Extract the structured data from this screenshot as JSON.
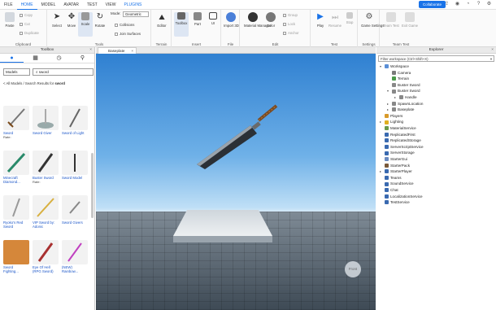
{
  "menubar": {
    "file": "FILE",
    "tabs": [
      "HOME",
      "MODEL",
      "AVATAR",
      "TEST",
      "VIEW",
      "PLUGINS"
    ],
    "collaborate": "Collaborate"
  },
  "ribbon": {
    "clipboard": {
      "paste": "Paste",
      "copy": "Copy",
      "cut": "Cut",
      "duplicate": "Duplicate",
      "label": "Clipboard"
    },
    "tools": {
      "select": "Select",
      "move": "Move",
      "scale": "Scale",
      "rotate": "Rotate",
      "label": "Tools"
    },
    "mode": {
      "label": "Mode:",
      "value": "Geometric",
      "collisions": "Collisions",
      "join_surfaces": "Join Surfaces"
    },
    "terrain": {
      "editor": "Editor",
      "label": "Terrain"
    },
    "insert": {
      "toolbox": "Toolbox",
      "part": "Part",
      "ui": "UI",
      "label": "Insert"
    },
    "file": {
      "import3d": "Import 3D",
      "label": "File"
    },
    "edit": {
      "material_manager": "Material Manager",
      "color": "Color",
      "group": "Group",
      "lock": "Lock",
      "anchor": "Anchor",
      "label": "Edit"
    },
    "test": {
      "play": "Play",
      "resume": "Resume",
      "stop": "Stop",
      "label": "Test"
    },
    "settings": {
      "game_settings": "Game Settings",
      "label": "Settings"
    },
    "team_test": {
      "team_test": "Team Test",
      "exit_game": "Exit Game",
      "label": "Team Test"
    }
  },
  "toolbox": {
    "title": "Toolbox",
    "category": "Models",
    "search": "sword",
    "crumb_prefix": "< All Models / Search Results for ",
    "crumb_term": "sword",
    "items": [
      {
        "name": "Sword",
        "rate": "Rate:"
      },
      {
        "name": "Sword Giver",
        "rate": ""
      },
      {
        "name": "Sword of Light",
        "rate": ""
      },
      {
        "name": "Minecraft Diamond...",
        "rate": ""
      },
      {
        "name": "Buster Sword",
        "rate": "Rate:"
      },
      {
        "name": "Sword Model",
        "rate": ""
      },
      {
        "name": "Ryoko's Red Sword",
        "rate": ""
      },
      {
        "name": "VIP Sword by: Adonic",
        "rate": ""
      },
      {
        "name": "Sword Givers",
        "rate": ""
      },
      {
        "name": "Sword Fighting...",
        "rate": ""
      },
      {
        "name": "Eye Of Hell (RPG Sword)",
        "rate": ""
      },
      {
        "name": "(NEW) Rainbow...",
        "rate": ""
      }
    ]
  },
  "viewport": {
    "tab": "Baseplate",
    "cube_label": "Front"
  },
  "explorer": {
    "title": "Explorer",
    "filter": "Filter workspace (Ctrl+Shift+X)",
    "tree": [
      {
        "label": "Workspace",
        "depth": 0,
        "arrow": "▾",
        "color": "#5b8fd6"
      },
      {
        "label": "Camera",
        "depth": 1,
        "arrow": "",
        "color": "#7a7a7a"
      },
      {
        "label": "Terrain",
        "depth": 1,
        "arrow": "",
        "color": "#4a9a4a"
      },
      {
        "label": "Buster Sword",
        "depth": 1,
        "arrow": "",
        "color": "#888"
      },
      {
        "label": "Buster Sword",
        "depth": 1,
        "arrow": "▾",
        "color": "#888"
      },
      {
        "label": "Handle",
        "depth": 2,
        "arrow": "▸",
        "color": "#888"
      },
      {
        "label": "SpawnLocation",
        "depth": 1,
        "arrow": "▸",
        "color": "#888"
      },
      {
        "label": "Baseplate",
        "depth": 1,
        "arrow": "▸",
        "color": "#888"
      },
      {
        "label": "Players",
        "depth": 0,
        "arrow": "",
        "color": "#d89a2a"
      },
      {
        "label": "Lighting",
        "depth": 0,
        "arrow": "▸",
        "color": "#e0b020"
      },
      {
        "label": "MaterialService",
        "depth": 0,
        "arrow": "",
        "color": "#6a9a4a"
      },
      {
        "label": "ReplicatedFirst",
        "depth": 0,
        "arrow": "",
        "color": "#3a6ab0"
      },
      {
        "label": "ReplicatedStorage",
        "depth": 0,
        "arrow": "",
        "color": "#3a6ab0"
      },
      {
        "label": "ServerScriptService",
        "depth": 0,
        "arrow": "",
        "color": "#3a6ab0"
      },
      {
        "label": "ServerStorage",
        "depth": 0,
        "arrow": "",
        "color": "#3a6ab0"
      },
      {
        "label": "StarterGui",
        "depth": 0,
        "arrow": "",
        "color": "#6a8ac0"
      },
      {
        "label": "StarterPack",
        "depth": 0,
        "arrow": "",
        "color": "#7a5a3a"
      },
      {
        "label": "StarterPlayer",
        "depth": 0,
        "arrow": "▸",
        "color": "#3a6ab0"
      },
      {
        "label": "Teams",
        "depth": 0,
        "arrow": "",
        "color": "#3a6ab0"
      },
      {
        "label": "SoundService",
        "depth": 0,
        "arrow": "",
        "color": "#3a6ab0"
      },
      {
        "label": "Chat",
        "depth": 0,
        "arrow": "",
        "color": "#3a6ab0"
      },
      {
        "label": "LocalizationService",
        "depth": 0,
        "arrow": "",
        "color": "#3a6ab0"
      },
      {
        "label": "TestService",
        "depth": 0,
        "arrow": "",
        "color": "#3a6ab0"
      }
    ]
  },
  "colors": {
    "accent": "#1a73e8",
    "sky_top": "#2f80d1",
    "ground": "#5b6873"
  }
}
